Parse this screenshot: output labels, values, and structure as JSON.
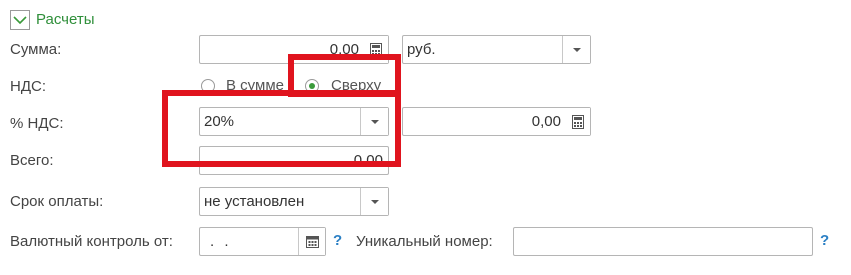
{
  "group": {
    "title": "Расчеты",
    "collapse_icon": "chevron-down-icon"
  },
  "amount": {
    "label": "Сумма:",
    "value": "0,00",
    "calc_icon": "calculator-icon",
    "currency": "руб.",
    "currency_dropdown_icon": "triangle-down-icon"
  },
  "vat_mode": {
    "label": "НДС:",
    "options": [
      "В сумме",
      "Сверху"
    ],
    "selected": "Сверху"
  },
  "vat_rate": {
    "label": "% НДС:",
    "value": "20%",
    "dropdown_icon": "triangle-down-icon",
    "vat_amount": "0,00",
    "calc_icon": "calculator-icon"
  },
  "total": {
    "label": "Всего:",
    "value": "0,00"
  },
  "payment_term": {
    "label": "Срок оплаты:",
    "value": "не установлен",
    "dropdown_icon": "triangle-down-icon"
  },
  "currency_control": {
    "label": "Валютный контроль от:",
    "date_value": " .  .",
    "calendar_icon": "calendar-icon",
    "help": "?"
  },
  "unique_number": {
    "label": "Уникальный номер:",
    "value": "",
    "help": "?"
  },
  "colors": {
    "accent_green": "#3a9a3a",
    "highlight_red": "#e0141e",
    "help_blue": "#2a7fc4"
  }
}
